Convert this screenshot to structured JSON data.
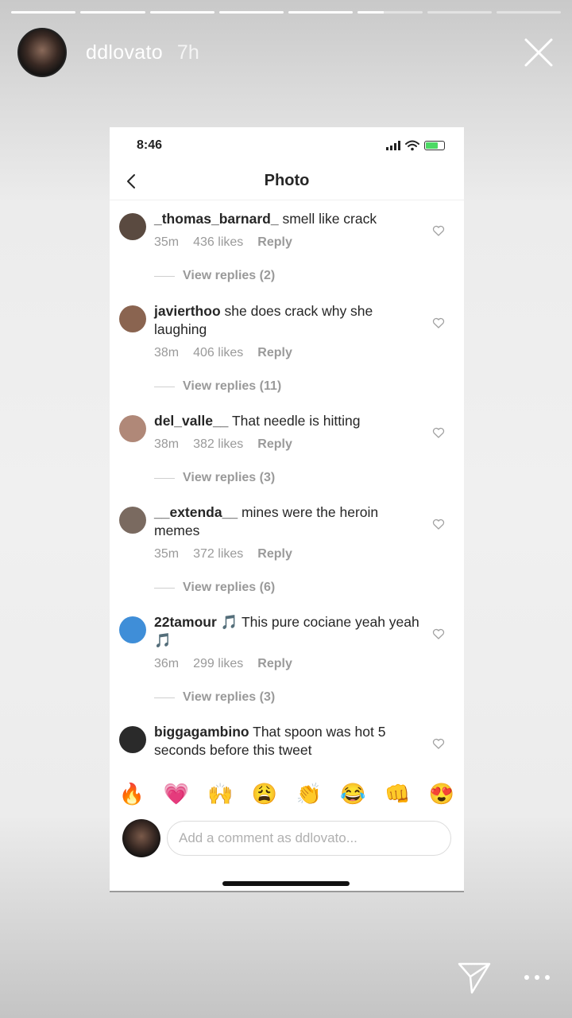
{
  "story": {
    "username": "ddlovato",
    "time": "7h",
    "segment_count": 8,
    "active_segment": 6,
    "active_progress": 0.4
  },
  "screenshot": {
    "status_time": "8:46",
    "nav_title": "Photo",
    "comments": [
      {
        "username": "_thomas_barnard_",
        "text": "smell like crack",
        "time": "35m",
        "likes": "436 likes",
        "reply": "Reply",
        "view_replies": "View replies (2)",
        "avatar_color": "#5a4a40"
      },
      {
        "username": "javierthoo",
        "text": "she does crack why she laughing",
        "time": "38m",
        "likes": "406 likes",
        "reply": "Reply",
        "view_replies": "View replies (11)",
        "avatar_color": "#8a6450"
      },
      {
        "username": "del_valle__",
        "text": "That needle is hitting",
        "time": "38m",
        "likes": "382 likes",
        "reply": "Reply",
        "view_replies": "View replies (3)",
        "avatar_color": "#b08878"
      },
      {
        "username": "__extenda__",
        "text": "mines were the heroin memes",
        "time": "35m",
        "likes": "372 likes",
        "reply": "Reply",
        "view_replies": "View replies (6)",
        "avatar_color": "#7a6a60"
      },
      {
        "username": "22tamour",
        "text": "🎵 This pure cociane yeah yeah 🎵",
        "time": "36m",
        "likes": "299 likes",
        "reply": "Reply",
        "view_replies": "View replies (3)",
        "avatar_color": "#3f8ed8"
      },
      {
        "username": "biggagambino",
        "text": "That spoon was hot 5 seconds before this tweet",
        "time": "",
        "likes": "",
        "reply": "",
        "view_replies": "",
        "avatar_color": "#2a2a2a"
      }
    ],
    "emojis": [
      "🔥",
      "💗",
      "🙌",
      "😩",
      "👏",
      "😂",
      "👊",
      "😍"
    ],
    "compose_placeholder": "Add a comment as ddlovato..."
  },
  "icons": {
    "close": "close-icon",
    "back": "chevron-left-icon",
    "heart": "heart-outline-icon",
    "send": "paper-plane-icon",
    "more": "more-horizontal-icon"
  }
}
